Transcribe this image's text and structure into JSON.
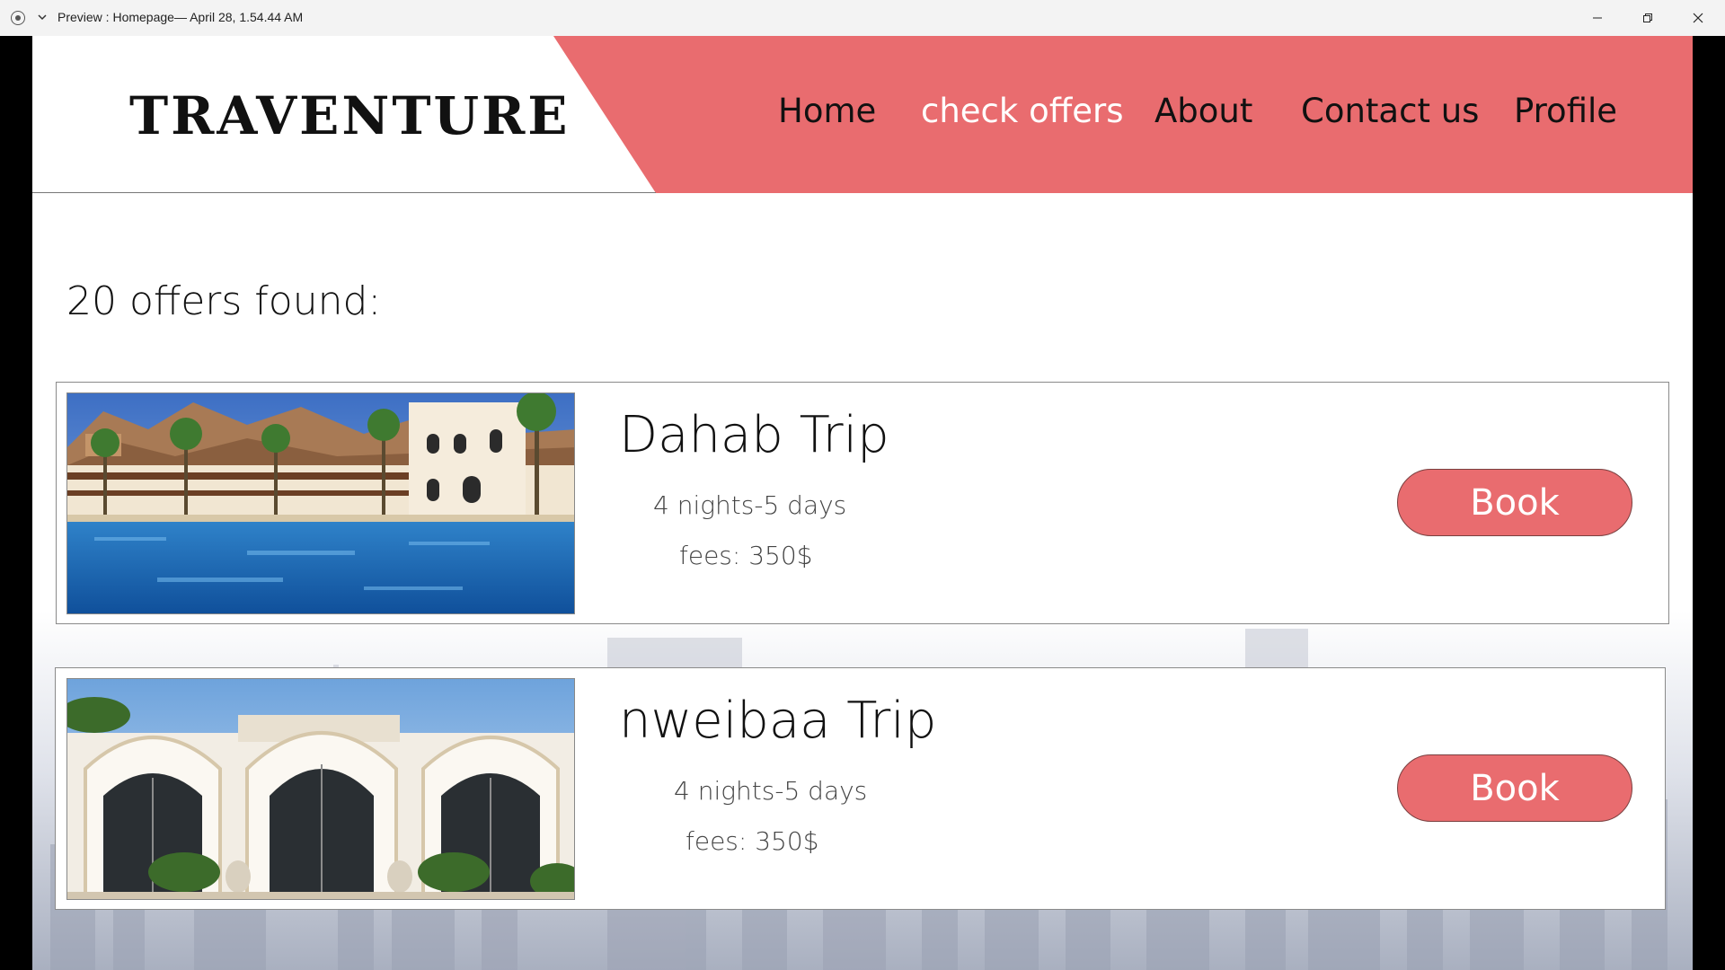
{
  "window": {
    "title": "Preview : Homepage— April 28, 1.54.44 AM"
  },
  "header": {
    "logo": "TRAVENTURE",
    "nav": [
      {
        "label": "Home"
      },
      {
        "label": "check offers"
      },
      {
        "label": "About"
      },
      {
        "label": "Contact us"
      },
      {
        "label": "Profile"
      }
    ],
    "accent_color": "#e96c6f"
  },
  "main": {
    "results_text": "20 offers found:",
    "offers": [
      {
        "title": "Dahab Trip",
        "duration": "4 nights-5 days",
        "fees": "fees: 350$",
        "book_label": "Book",
        "image": "resort-pool-photo"
      },
      {
        "title": "nweibaa Trip",
        "duration": "4 nights-5 days",
        "fees": "fees: 350$",
        "book_label": "Book",
        "image": "white-arched-building-photo"
      }
    ]
  }
}
